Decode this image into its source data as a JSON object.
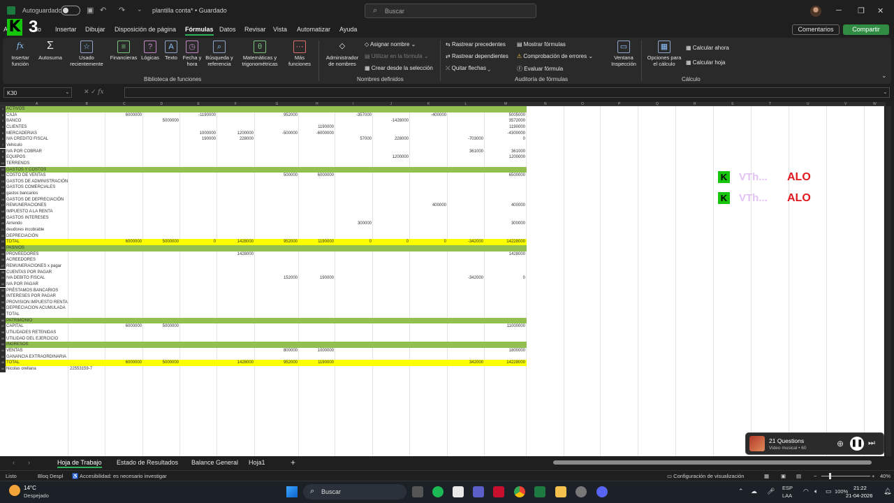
{
  "titlebar": {
    "autosave_label": "Autoguardado",
    "doc_title": "plantilla conta* • Guardado",
    "search_placeholder": "Buscar"
  },
  "logo": {
    "k": "K",
    "three": "3"
  },
  "menu": {
    "items": [
      "Archivo",
      "Inicio",
      "Insertar",
      "Dibujar",
      "Disposición de página",
      "Fórmulas",
      "Datos",
      "Revisar",
      "Vista",
      "Automatizar",
      "Ayuda"
    ],
    "visible_labels": [
      "A",
      "io",
      "Insertar",
      "Dibujar",
      "Disposición de página",
      "Fórmulas",
      "Datos",
      "Revisar",
      "Vista",
      "Automatizar",
      "Ayuda"
    ],
    "active": "Fórmulas",
    "comments": "Comentarios",
    "share": "Compartir"
  },
  "ribbon": {
    "insert_function": "Insertar función",
    "autosum": "Autosuma",
    "recent": "Usado recientemente",
    "financial": "Financieras",
    "logical": "Lógicas",
    "text": "Texto",
    "datetime": "Fecha y hora",
    "lookup": "Búsqueda y referencia",
    "math": "Matemáticas y trigonométricas",
    "more": "Más funciones",
    "group_library": "Biblioteca de funciones",
    "name_manager": "Administrador de nombres",
    "define_name": "Asignar nombre",
    "use_in_formula": "Utilizar en la fórmula",
    "create_from_selection": "Crear desde la selección",
    "group_names": "Nombres definidos",
    "trace_precedents": "Rastrear precedentes",
    "trace_dependents": "Rastrear dependientes",
    "remove_arrows": "Quitar flechas",
    "show_formulas": "Mostrar fórmulas",
    "error_checking": "Comprobación de errores",
    "evaluate_formula": "Evaluar fórmula",
    "group_audit": "Auditoría de fórmulas",
    "watch_window": "Ventana Inspección",
    "calc_options": "Opciones para el cálculo",
    "calc_now": "Calcular ahora",
    "calc_sheet": "Calcular hoja",
    "group_calc": "Cálculo"
  },
  "formula_bar": {
    "name_box": "K30",
    "formula": ""
  },
  "columns": [
    "A",
    "B",
    "C",
    "D",
    "E",
    "F",
    "G",
    "H",
    "I",
    "J",
    "K",
    "L",
    "M",
    "N",
    "O",
    "P",
    "Q",
    "R",
    "S",
    "T",
    "U",
    "V",
    "W"
  ],
  "sheet_rows": [
    {
      "n": "1",
      "label": "ACTIVOS",
      "band": "green",
      "cells": {}
    },
    {
      "n": "2",
      "label": "CAJA",
      "cells": {
        "C": "6000000",
        "E": "-1190000",
        "G": "952000",
        "I": "-357000",
        "K": "-400000",
        "M": "5005000"
      }
    },
    {
      "n": "3",
      "label": "BANCO",
      "cells": {
        "D": "5000000",
        "J": "-1428000",
        "M": "3572000"
      }
    },
    {
      "n": "4",
      "label": "CLIENTES",
      "cells": {
        "H": "1190000",
        "M": "1190000"
      }
    },
    {
      "n": "5",
      "label": "MERCADERIAS",
      "cells": {
        "E": "1000000",
        "F": "1200000",
        "G": "-500000",
        "H": "-6000000",
        "M": "-4300000"
      }
    },
    {
      "n": "6",
      "label": "IVA CREDITO FISCAL",
      "cells": {
        "E": "190000",
        "F": "228000",
        "I": "57000",
        "J": "228000",
        "L": "-703000",
        "M": "0"
      }
    },
    {
      "n": "7",
      "label": "Vehiculo",
      "cells": {}
    },
    {
      "n": "8",
      "label": "IVA POR COBRAR",
      "cells": {
        "L": "361000",
        "M": "361000"
      }
    },
    {
      "n": "9",
      "label": "EQUIPOS",
      "cells": {
        "J": "1200000",
        "M": "1200000"
      }
    },
    {
      "n": "10",
      "label": "TERRENOS",
      "cells": {}
    },
    {
      "n": "11",
      "label": "GASTOS Y COSTOS",
      "band": "green",
      "cells": {}
    },
    {
      "n": "12",
      "label": "COSTO DE VENTAS",
      "cells": {
        "G": "500000",
        "H": "6000000",
        "M": "6500000"
      }
    },
    {
      "n": "13",
      "label": "GASTOS DE ADMINISTRACIÓN",
      "cells": {}
    },
    {
      "n": "14",
      "label": "GASTOS COMERCIALES",
      "cells": {}
    },
    {
      "n": "15",
      "label": "gastos bancarios",
      "cells": {}
    },
    {
      "n": "16",
      "label": "GASTOS DE DEPRECIACIÓN",
      "cells": {}
    },
    {
      "n": "17",
      "label": "REMUNERACIONES",
      "cells": {
        "K": "400000",
        "M": "400000"
      }
    },
    {
      "n": "18",
      "label": "IMPUESTO A LA RENTA",
      "cells": {}
    },
    {
      "n": "19",
      "label": "GASTOS INTERESES",
      "cells": {}
    },
    {
      "n": "20",
      "label": "Arriendo",
      "cells": {
        "I": "300000",
        "M": "300000"
      }
    },
    {
      "n": "21",
      "label": "deudores incobrable",
      "cells": {}
    },
    {
      "n": "22",
      "label": "DEPRECIACIÓN",
      "cells": {}
    },
    {
      "n": "23",
      "label": "TOTAL",
      "band": "yellow",
      "cells": {
        "C": "6000000",
        "D": "5000000",
        "E": "0",
        "F": "1428000",
        "G": "952000",
        "H": "1190000",
        "I": "0",
        "J": "0",
        "K": "0",
        "L": "-342000",
        "M": "14228000"
      }
    },
    {
      "n": "24",
      "label": "PASIVOS",
      "band": "green",
      "cells": {}
    },
    {
      "n": "25",
      "label": "PROVEEDORES",
      "cells": {
        "F": "1428000",
        "M": "1428000"
      }
    },
    {
      "n": "26",
      "label": "ACREEDORES",
      "cells": {}
    },
    {
      "n": "27",
      "label": "REMUNERACIONES x pagar",
      "cells": {}
    },
    {
      "n": "28",
      "label": "CUENTAS POR PAGAR",
      "cells": {}
    },
    {
      "n": "29",
      "label": "IVA DEBITO FISCAL",
      "cells": {
        "G": "152000",
        "H": "190000",
        "L": "-342000",
        "M": "0"
      }
    },
    {
      "n": "30",
      "label": "IVA POR PAGAR",
      "cells": {}
    },
    {
      "n": "31",
      "label": "PRÉSTAMOS BANCARIOS",
      "cells": {}
    },
    {
      "n": "32",
      "label": "INTERESES POR PAGAR",
      "cells": {}
    },
    {
      "n": "33",
      "label": "PROVISION IMPUESTO RENTA",
      "cells": {}
    },
    {
      "n": "34",
      "label": "DEPRECIACION ACUMULADA",
      "cells": {}
    },
    {
      "n": "35",
      "label": "TOTAL",
      "cells": {}
    },
    {
      "n": "36",
      "label": "PATRIMONIO",
      "band": "green",
      "cells": {}
    },
    {
      "n": "37",
      "label": "CAPITAL",
      "cells": {
        "C": "6000000",
        "D": "5000000",
        "M": "11000000"
      }
    },
    {
      "n": "38",
      "label": "UTILIDADES RETENIDAS",
      "cells": {}
    },
    {
      "n": "39",
      "label": "UTILIDAD DEL EJERCICIO",
      "cells": {}
    },
    {
      "n": "40",
      "label": "INGRESOS",
      "band": "green",
      "cells": {}
    },
    {
      "n": "41",
      "label": "VENTAS",
      "cells": {
        "G": "800000",
        "H": "1000000",
        "M": "1800000"
      }
    },
    {
      "n": "42",
      "label": "GANANCIA EXTRAORDINARIA",
      "cells": {}
    },
    {
      "n": "43",
      "label": "TOTAL",
      "band": "yellow",
      "cells": {
        "C": "6000000",
        "D": "5000000",
        "F": "1428000",
        "G": "952000",
        "H": "1190000",
        "L": "342000",
        "M": "14228000"
      }
    },
    {
      "n": "44",
      "label": "Nicolas orellana",
      "cells": {
        "B": "22553159-7"
      }
    }
  ],
  "overlay": {
    "k": "K",
    "name": "VTh...",
    "alo": "ALO"
  },
  "media": {
    "title": "21 Questions",
    "subtitle": "Video musical • 60"
  },
  "tabs": [
    "Hoja de Trabajo",
    "Estado de Resultados",
    "Balance General",
    "Hoja1"
  ],
  "active_tab": "Hoja de Trabajo",
  "status": {
    "ready": "Listo",
    "scroll_lock": "Bloq Despl",
    "accessibility": "Accesibilidad: es necesario investigar",
    "view_settings": "Configuración de visualización",
    "zoom": "40%"
  },
  "taskbar": {
    "temp": "14°C",
    "weather": "Despejado",
    "search": "Buscar",
    "lang": "ESP",
    "lang2": "LAA",
    "battery": "100%",
    "time": "21:22",
    "date": "21-04-2026"
  },
  "colors": {
    "green_band": "#92c050",
    "yellow_band": "#fbff00",
    "accent": "#2fb35b"
  }
}
